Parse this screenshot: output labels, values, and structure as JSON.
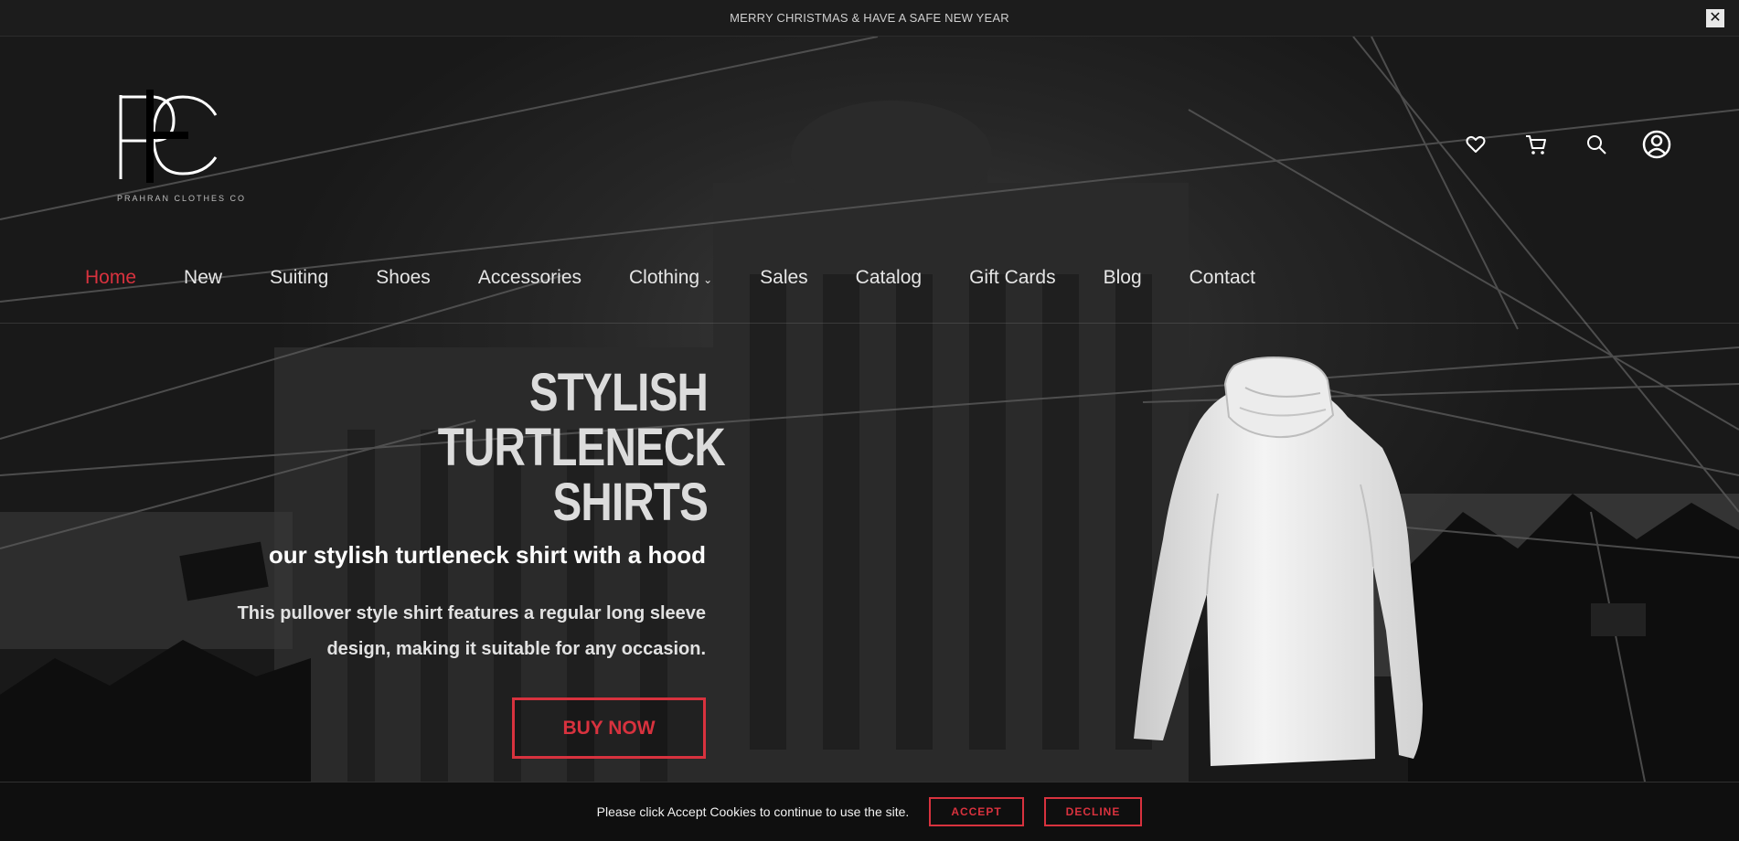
{
  "announcement": {
    "text": "MERRY CHRISTMAS & HAVE A SAFE NEW YEAR",
    "close_label": "✕"
  },
  "header": {
    "logo_caption": "PRAHRAN CLOTHES CO",
    "icons": [
      "heart-icon",
      "cart-icon",
      "search-icon",
      "account-icon"
    ]
  },
  "nav": {
    "items": [
      {
        "label": "Home",
        "active": true
      },
      {
        "label": "New"
      },
      {
        "label": "Suiting"
      },
      {
        "label": "Shoes"
      },
      {
        "label": "Accessories"
      },
      {
        "label": "Clothing",
        "dropdown": true
      },
      {
        "label": "Sales"
      },
      {
        "label": "Catalog"
      },
      {
        "label": "Gift Cards"
      },
      {
        "label": "Blog"
      },
      {
        "label": "Contact"
      }
    ],
    "dropdown_glyph": "⌄"
  },
  "hero": {
    "heading_line1": "STYLISH",
    "heading_line2": "TURTLENECK",
    "heading_line3": "SHIRTS",
    "subtitle": "our stylish turtleneck shirt with a hood",
    "description": "This pullover style shirt features a regular long sleeve design, making it suitable for any occasion.",
    "cta_label": "BUY NOW"
  },
  "cookie": {
    "text": "Please click Accept Cookies to continue to use the site.",
    "accept_label": "ACCEPT",
    "decline_label": "DECLINE"
  },
  "colors": {
    "accent": "#d8323e",
    "background": "#1b1b1b",
    "text": "#e6e6e6"
  }
}
